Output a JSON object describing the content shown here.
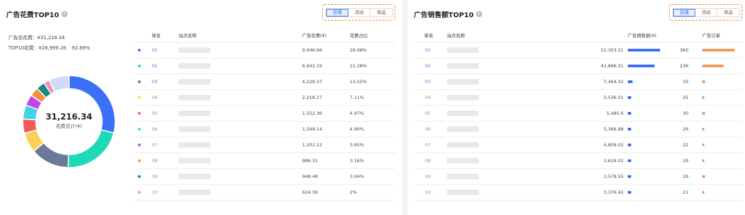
{
  "left": {
    "title": "广告花费TOP10",
    "help_icon": "?",
    "segments": [
      "店铺",
      "活动",
      "商品"
    ],
    "active_segment": 0,
    "summary_total_label": "广告总花费：",
    "summary_total_value": "¥31,216.34",
    "summary_top10_label": "TOP10花费：",
    "summary_top10_value": "¥28,999.26",
    "summary_top10_pct": "92.89%",
    "donut_value": "31,216.34",
    "donut_label": "花费总计(¥)",
    "headers": {
      "rank": "排名",
      "site": "站点名称",
      "spend": "广告花费(¥)",
      "pct": "花费占比"
    },
    "rows": [
      {
        "rank": "01",
        "spend": "9,046.66",
        "pct": "28.98%",
        "color": "#3b6ff5"
      },
      {
        "rank": "02",
        "spend": "6,642.19",
        "pct": "21.28%",
        "color": "#1ed9b6"
      },
      {
        "rank": "03",
        "spend": "4,229.37",
        "pct": "13.55%",
        "color": "#6b7a99"
      },
      {
        "rank": "04",
        "spend": "2,218.27",
        "pct": "7.11%",
        "color": "#fcd15a"
      },
      {
        "rank": "05",
        "spend": "1,552.36",
        "pct": "4.97%",
        "color": "#f25a5a"
      },
      {
        "rank": "06",
        "spend": "1,549.14",
        "pct": "4.96%",
        "color": "#3fd4ec"
      },
      {
        "rank": "07",
        "spend": "1,202.12",
        "pct": "3.85%",
        "color": "#c346e6"
      },
      {
        "rank": "08",
        "spend": "986.31",
        "pct": "3.16%",
        "color": "#f2933c"
      },
      {
        "rank": "09",
        "spend": "948.48",
        "pct": "3.04%",
        "color": "#138a7e"
      },
      {
        "rank": "10",
        "spend": "624.36",
        "pct": "2%",
        "color": "#f28fb8"
      }
    ],
    "other_color": "#cfdcf8"
  },
  "right": {
    "title": "广告销售额TOP10",
    "help_icon": "?",
    "segments": [
      "店铺",
      "活动",
      "商品"
    ],
    "active_segment": 0,
    "headers": {
      "rank": "排名",
      "site": "站点名称",
      "sales": "广告销售额(¥)",
      "orders": "广告订单"
    },
    "sales_color": "#3b6ff5",
    "orders_color": "#f2995a",
    "rows": [
      {
        "rank": "01",
        "sales": "52,303.21",
        "sales_value": 52303.21,
        "orders": "360",
        "orders_value": 360
      },
      {
        "rank": "02",
        "sales": "42,896.31",
        "sales_value": 42896.31,
        "orders": "236",
        "orders_value": 236
      },
      {
        "rank": "03",
        "sales": "7,464.32",
        "sales_value": 7464.32,
        "orders": "33",
        "orders_value": 33
      },
      {
        "rank": "04",
        "sales": "5,536.01",
        "sales_value": 5536.01,
        "orders": "25",
        "orders_value": 25
      },
      {
        "rank": "05",
        "sales": "5,485.6",
        "sales_value": 5485.6,
        "orders": "30",
        "orders_value": 30
      },
      {
        "rank": "06",
        "sales": "5,366.88",
        "sales_value": 5366.88,
        "orders": "26",
        "orders_value": 26
      },
      {
        "rank": "07",
        "sales": "4,809.02",
        "sales_value": 4809.02,
        "orders": "22",
        "orders_value": 22
      },
      {
        "rank": "08",
        "sales": "3,619.02",
        "sales_value": 3619.02,
        "orders": "19",
        "orders_value": 19
      },
      {
        "rank": "09",
        "sales": "3,579.55",
        "sales_value": 3579.55,
        "orders": "29",
        "orders_value": 29
      },
      {
        "rank": "10",
        "sales": "3,376.42",
        "sales_value": 3376.42,
        "orders": "21",
        "orders_value": 21
      }
    ]
  }
}
